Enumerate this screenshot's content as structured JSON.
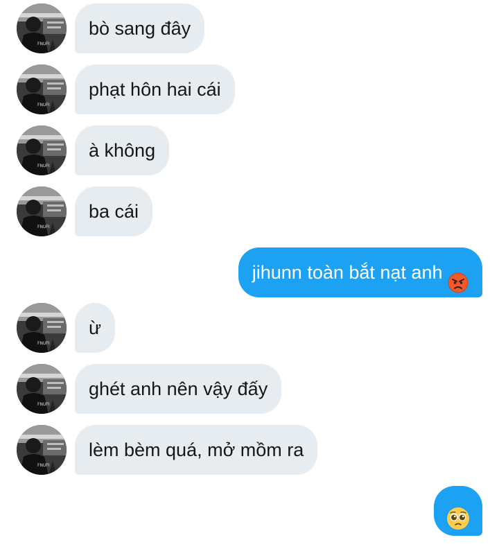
{
  "conversation": {
    "messages": [
      {
        "from": "other",
        "text": "bò sang đây"
      },
      {
        "from": "other",
        "text": "phạt hôn hai cái"
      },
      {
        "from": "other",
        "text": "à không"
      },
      {
        "from": "other",
        "text": "ba cái"
      },
      {
        "from": "me",
        "text": "jihunn toàn bắt nạt anh",
        "emoji": "angry-face-emoji"
      },
      {
        "from": "other",
        "text": "ừ"
      },
      {
        "from": "other",
        "text": "ghét anh nên vậy đấy"
      },
      {
        "from": "other",
        "text": "lèm bèm quá, mở mồm ra"
      },
      {
        "from": "me",
        "text": "",
        "emoji": "pleading-face-emoji"
      }
    ]
  },
  "colors": {
    "incoming_bubble": "#e6ecf0",
    "outgoing_bubble": "#1da1f2",
    "incoming_text": "#14171a",
    "outgoing_text": "#ffffff"
  }
}
